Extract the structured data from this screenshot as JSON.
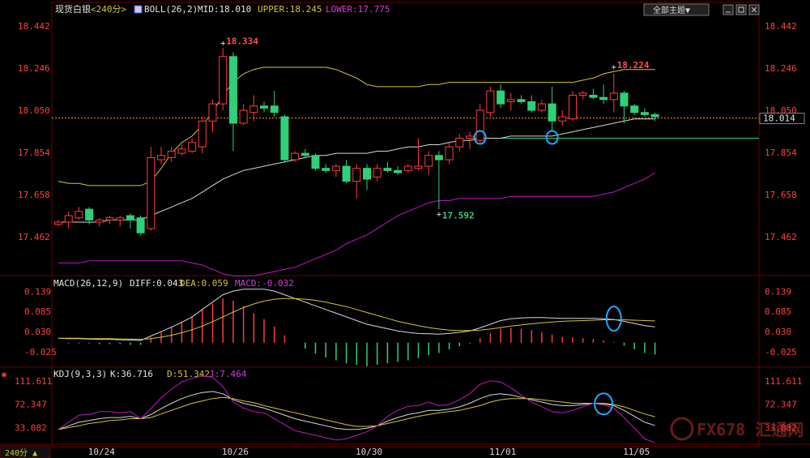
{
  "header": {
    "instrument": "现货白银",
    "period": "<240分>",
    "boll_label": "BOLL(26,2)",
    "mid_label": "MID:18.010",
    "upper_label": "UPPER:18.245",
    "lower_label": "LOWER:17.775",
    "theme_button": "全部主题▼"
  },
  "macd_header": {
    "label": "MACD(26,12,9)",
    "diff_label": "DIFF:0.043",
    "dea_label": "DEA:0.059",
    "macd_label": "MACD:-0.032"
  },
  "kdj_header": {
    "label": "KDJ(9,3,3)",
    "k_label": "K:36.716",
    "d_label": "D:51.342",
    "j_label": "J:7.464"
  },
  "period_button": "240分 ▲",
  "watermark": "FX678 汇通网",
  "colors": {
    "up": "#ff3b3b",
    "down": "#2fd07a",
    "upper": "#d4c434",
    "mid": "#d8d8d8",
    "lower": "#c018c0",
    "axis_text": "#ff4040",
    "header_text": "#d0d0d0",
    "dea": "#d4c434",
    "macd_neg": "#c018c0",
    "current_line": "#ff9900"
  },
  "chart_data": [
    {
      "type": "candlestick",
      "price_axis": {
        "ticks": [
          "18.442",
          "18.246",
          "18.050",
          "17.854",
          "17.658",
          "17.462"
        ],
        "ylim": [
          17.3,
          18.48
        ]
      },
      "x_labels": [
        {
          "label": "10/24",
          "index": 4
        },
        {
          "label": "10/26",
          "index": 17
        },
        {
          "label": "10/30",
          "index": 30
        },
        {
          "label": "11/01",
          "index": 43
        },
        {
          "label": "11/05",
          "index": 56
        }
      ],
      "annotations": [
        {
          "label": "18.334",
          "index": 16,
          "value": 18.334,
          "kind": "high"
        },
        {
          "label": "17.592",
          "index": 37,
          "value": 17.592,
          "kind": "low"
        },
        {
          "label": "18.224",
          "index": 54,
          "value": 18.224,
          "kind": "high"
        }
      ],
      "current_price": {
        "label": "18.014",
        "value": 18.014
      },
      "support_level": 17.92,
      "circles": [
        {
          "index": 41,
          "value": 17.92
        },
        {
          "index": 48,
          "value": 17.92
        }
      ],
      "candles": [
        {
          "o": 17.52,
          "h": 17.54,
          "l": 17.51,
          "c": 17.53
        },
        {
          "o": 17.53,
          "h": 17.58,
          "l": 17.5,
          "c": 17.56
        },
        {
          "o": 17.55,
          "h": 17.6,
          "l": 17.54,
          "c": 17.58
        },
        {
          "o": 17.59,
          "h": 17.6,
          "l": 17.52,
          "c": 17.54
        },
        {
          "o": 17.53,
          "h": 17.55,
          "l": 17.51,
          "c": 17.54
        },
        {
          "o": 17.54,
          "h": 17.56,
          "l": 17.52,
          "c": 17.55
        },
        {
          "o": 17.54,
          "h": 17.56,
          "l": 17.51,
          "c": 17.55
        },
        {
          "o": 17.56,
          "h": 17.57,
          "l": 17.5,
          "c": 17.54
        },
        {
          "o": 17.55,
          "h": 17.56,
          "l": 17.47,
          "c": 17.48
        },
        {
          "o": 17.5,
          "h": 17.88,
          "l": 17.49,
          "c": 17.83
        },
        {
          "o": 17.82,
          "h": 17.88,
          "l": 17.8,
          "c": 17.84
        },
        {
          "o": 17.83,
          "h": 17.88,
          "l": 17.81,
          "c": 17.86
        },
        {
          "o": 17.85,
          "h": 17.89,
          "l": 17.84,
          "c": 17.87
        },
        {
          "o": 17.86,
          "h": 17.92,
          "l": 17.85,
          "c": 17.9
        },
        {
          "o": 17.88,
          "h": 18.02,
          "l": 17.85,
          "c": 18.0
        },
        {
          "o": 18.0,
          "h": 18.1,
          "l": 17.95,
          "c": 18.08
        },
        {
          "o": 18.08,
          "h": 18.34,
          "l": 18.05,
          "c": 18.3
        },
        {
          "o": 18.3,
          "h": 18.32,
          "l": 17.86,
          "c": 17.99
        },
        {
          "o": 17.99,
          "h": 18.08,
          "l": 17.98,
          "c": 18.05
        },
        {
          "o": 18.04,
          "h": 18.12,
          "l": 18.0,
          "c": 18.07
        },
        {
          "o": 18.07,
          "h": 18.09,
          "l": 18.04,
          "c": 18.06
        },
        {
          "o": 18.07,
          "h": 18.14,
          "l": 18.02,
          "c": 18.04
        },
        {
          "o": 18.02,
          "h": 18.03,
          "l": 17.81,
          "c": 17.82
        },
        {
          "o": 17.82,
          "h": 17.86,
          "l": 17.81,
          "c": 17.85
        },
        {
          "o": 17.85,
          "h": 17.87,
          "l": 17.83,
          "c": 17.84
        },
        {
          "o": 17.84,
          "h": 17.85,
          "l": 17.77,
          "c": 17.78
        },
        {
          "o": 17.78,
          "h": 17.8,
          "l": 17.76,
          "c": 17.77
        },
        {
          "o": 17.77,
          "h": 17.8,
          "l": 17.74,
          "c": 17.79
        },
        {
          "o": 17.79,
          "h": 17.82,
          "l": 17.71,
          "c": 17.72
        },
        {
          "o": 17.72,
          "h": 17.8,
          "l": 17.64,
          "c": 17.78
        },
        {
          "o": 17.78,
          "h": 17.8,
          "l": 17.68,
          "c": 17.73
        },
        {
          "o": 17.74,
          "h": 17.8,
          "l": 17.72,
          "c": 17.78
        },
        {
          "o": 17.78,
          "h": 17.81,
          "l": 17.76,
          "c": 17.77
        },
        {
          "o": 17.77,
          "h": 17.79,
          "l": 17.75,
          "c": 17.76
        },
        {
          "o": 17.77,
          "h": 17.8,
          "l": 17.76,
          "c": 17.79
        },
        {
          "o": 17.78,
          "h": 17.92,
          "l": 17.77,
          "c": 17.79
        },
        {
          "o": 17.79,
          "h": 17.86,
          "l": 17.75,
          "c": 17.84
        },
        {
          "o": 17.84,
          "h": 17.86,
          "l": 17.59,
          "c": 17.82
        },
        {
          "o": 17.82,
          "h": 17.9,
          "l": 17.8,
          "c": 17.88
        },
        {
          "o": 17.88,
          "h": 17.94,
          "l": 17.86,
          "c": 17.92
        },
        {
          "o": 17.92,
          "h": 17.95,
          "l": 17.87,
          "c": 17.93
        },
        {
          "o": 17.91,
          "h": 18.08,
          "l": 17.9,
          "c": 18.05
        },
        {
          "o": 18.04,
          "h": 18.16,
          "l": 18.02,
          "c": 18.14
        },
        {
          "o": 18.14,
          "h": 18.17,
          "l": 18.06,
          "c": 18.08
        },
        {
          "o": 18.09,
          "h": 18.13,
          "l": 18.05,
          "c": 18.1
        },
        {
          "o": 18.1,
          "h": 18.12,
          "l": 18.08,
          "c": 18.09
        },
        {
          "o": 18.09,
          "h": 18.12,
          "l": 18.04,
          "c": 18.05
        },
        {
          "o": 18.05,
          "h": 18.1,
          "l": 18.04,
          "c": 18.08
        },
        {
          "o": 18.08,
          "h": 18.16,
          "l": 17.95,
          "c": 18.0
        },
        {
          "o": 18.0,
          "h": 18.05,
          "l": 17.98,
          "c": 18.02
        },
        {
          "o": 18.01,
          "h": 18.14,
          "l": 18.0,
          "c": 18.12
        },
        {
          "o": 18.12,
          "h": 18.14,
          "l": 18.1,
          "c": 18.13
        },
        {
          "o": 18.12,
          "h": 18.15,
          "l": 18.1,
          "c": 18.11
        },
        {
          "o": 18.11,
          "h": 18.17,
          "l": 18.08,
          "c": 18.1
        },
        {
          "o": 18.1,
          "h": 18.22,
          "l": 18.04,
          "c": 18.13
        },
        {
          "o": 18.13,
          "h": 18.14,
          "l": 17.99,
          "c": 18.07
        },
        {
          "o": 18.07,
          "h": 18.08,
          "l": 18.03,
          "c": 18.04
        },
        {
          "o": 18.04,
          "h": 18.06,
          "l": 18.02,
          "c": 18.03
        },
        {
          "o": 18.03,
          "h": 18.04,
          "l": 18.0,
          "c": 18.02
        }
      ],
      "series": [
        {
          "name": "UPPER",
          "values": [
            17.72,
            17.71,
            17.71,
            17.7,
            17.7,
            17.7,
            17.7,
            17.7,
            17.7,
            17.72,
            17.78,
            17.85,
            17.9,
            17.93,
            17.98,
            18.04,
            18.12,
            18.18,
            18.22,
            18.24,
            18.25,
            18.25,
            18.25,
            18.25,
            18.25,
            18.25,
            18.25,
            18.24,
            18.22,
            18.2,
            18.17,
            18.16,
            18.16,
            18.16,
            18.16,
            18.16,
            18.17,
            18.17,
            18.18,
            18.18,
            18.18,
            18.18,
            18.18,
            18.18,
            18.18,
            18.18,
            18.18,
            18.18,
            18.18,
            18.18,
            18.18,
            18.19,
            18.2,
            18.22,
            18.23,
            18.24,
            18.24,
            18.24,
            18.24
          ]
        },
        {
          "name": "MID",
          "values": [
            17.53,
            17.53,
            17.53,
            17.53,
            17.53,
            17.54,
            17.54,
            17.54,
            17.54,
            17.56,
            17.58,
            17.6,
            17.62,
            17.64,
            17.67,
            17.7,
            17.73,
            17.75,
            17.77,
            17.78,
            17.79,
            17.8,
            17.81,
            17.82,
            17.83,
            17.84,
            17.84,
            17.85,
            17.85,
            17.85,
            17.85,
            17.86,
            17.86,
            17.87,
            17.88,
            17.88,
            17.89,
            17.89,
            17.9,
            17.91,
            17.91,
            17.92,
            17.92,
            17.92,
            17.93,
            17.93,
            17.93,
            17.93,
            17.93,
            17.94,
            17.95,
            17.96,
            17.97,
            17.98,
            17.99,
            18.0,
            18.01,
            18.01,
            18.01
          ]
        },
        {
          "name": "LOWER",
          "values": [
            17.34,
            17.34,
            17.34,
            17.35,
            17.35,
            17.35,
            17.35,
            17.35,
            17.35,
            17.35,
            17.35,
            17.35,
            17.35,
            17.34,
            17.33,
            17.31,
            17.29,
            17.28,
            17.28,
            17.28,
            17.29,
            17.3,
            17.31,
            17.32,
            17.34,
            17.36,
            17.38,
            17.4,
            17.43,
            17.45,
            17.47,
            17.5,
            17.53,
            17.56,
            17.58,
            17.6,
            17.62,
            17.63,
            17.63,
            17.64,
            17.64,
            17.64,
            17.64,
            17.64,
            17.65,
            17.65,
            17.65,
            17.65,
            17.65,
            17.65,
            17.65,
            17.65,
            17.65,
            17.66,
            17.67,
            17.69,
            17.71,
            17.73,
            17.76
          ]
        }
      ]
    },
    {
      "type": "macd",
      "ticks": [
        "0.139",
        "0.085",
        "0.030",
        "-0.025"
      ],
      "ylim": [
        -0.06,
        0.16
      ],
      "series": [
        {
          "name": "DIFF",
          "values": [
            0.012,
            0.011,
            0.011,
            0.01,
            0.009,
            0.009,
            0.008,
            0.007,
            0.006,
            0.018,
            0.03,
            0.042,
            0.055,
            0.07,
            0.09,
            0.11,
            0.13,
            0.14,
            0.145,
            0.145,
            0.145,
            0.14,
            0.13,
            0.12,
            0.11,
            0.1,
            0.09,
            0.08,
            0.07,
            0.06,
            0.05,
            0.044,
            0.038,
            0.032,
            0.028,
            0.025,
            0.024,
            0.023,
            0.025,
            0.028,
            0.032,
            0.04,
            0.05,
            0.06,
            0.065,
            0.067,
            0.068,
            0.068,
            0.067,
            0.066,
            0.066,
            0.066,
            0.066,
            0.065,
            0.063,
            0.058,
            0.052,
            0.046,
            0.043
          ]
        },
        {
          "name": "DEA",
          "values": [
            0.012,
            0.012,
            0.012,
            0.011,
            0.011,
            0.011,
            0.01,
            0.01,
            0.009,
            0.011,
            0.015,
            0.02,
            0.027,
            0.035,
            0.045,
            0.057,
            0.07,
            0.083,
            0.095,
            0.105,
            0.113,
            0.118,
            0.12,
            0.12,
            0.118,
            0.115,
            0.11,
            0.104,
            0.098,
            0.09,
            0.082,
            0.074,
            0.066,
            0.058,
            0.052,
            0.046,
            0.041,
            0.037,
            0.034,
            0.033,
            0.033,
            0.034,
            0.037,
            0.041,
            0.045,
            0.048,
            0.051,
            0.054,
            0.056,
            0.058,
            0.059,
            0.06,
            0.061,
            0.062,
            0.062,
            0.062,
            0.061,
            0.06,
            0.059
          ]
        },
        {
          "name": "MACD",
          "values": [
            0.0,
            -0.002,
            -0.002,
            -0.002,
            -0.004,
            -0.004,
            -0.004,
            -0.006,
            -0.006,
            0.014,
            0.03,
            0.044,
            0.056,
            0.07,
            0.09,
            0.106,
            0.12,
            0.114,
            0.1,
            0.08,
            0.064,
            0.044,
            0.02,
            0.0,
            -0.016,
            -0.03,
            -0.04,
            -0.048,
            -0.056,
            -0.06,
            -0.064,
            -0.06,
            -0.056,
            -0.052,
            -0.048,
            -0.042,
            -0.034,
            -0.028,
            -0.018,
            -0.01,
            -0.002,
            0.012,
            0.026,
            0.038,
            0.04,
            0.038,
            0.034,
            0.028,
            0.022,
            0.016,
            0.014,
            0.012,
            0.01,
            0.006,
            0.002,
            -0.008,
            -0.018,
            -0.028,
            -0.032
          ]
        }
      ]
    },
    {
      "type": "kdj",
      "ticks": [
        "111.611",
        "72.347",
        "33.082"
      ],
      "ylim": [
        5,
        128
      ],
      "series": [
        {
          "name": "K",
          "values": [
            30,
            36,
            42,
            45,
            48,
            50,
            50,
            52,
            48,
            55,
            65,
            74,
            82,
            88,
            92,
            94,
            90,
            80,
            74,
            70,
            66,
            60,
            54,
            48,
            44,
            40,
            36,
            32,
            30,
            30,
            32,
            36,
            44,
            50,
            55,
            58,
            62,
            62,
            64,
            68,
            74,
            82,
            88,
            90,
            88,
            84,
            80,
            76,
            72,
            70,
            70,
            72,
            74,
            73,
            70,
            62,
            52,
            42,
            36.7
          ]
        },
        {
          "name": "D",
          "values": [
            30,
            33,
            36,
            40,
            42,
            45,
            46,
            48,
            48,
            50,
            56,
            62,
            68,
            74,
            78,
            82,
            84,
            82,
            78,
            75,
            70,
            66,
            62,
            58,
            54,
            50,
            46,
            42,
            38,
            35,
            35,
            36,
            40,
            44,
            48,
            52,
            55,
            58,
            60,
            62,
            66,
            70,
            76,
            80,
            82,
            82,
            82,
            80,
            78,
            76,
            74,
            74,
            74,
            74,
            72,
            68,
            62,
            56,
            51.3
          ]
        },
        {
          "name": "J",
          "values": [
            30,
            42,
            54,
            55,
            60,
            60,
            58,
            60,
            48,
            65,
            83,
            98,
            110,
            116,
            120,
            118,
            102,
            76,
            66,
            60,
            58,
            48,
            38,
            28,
            24,
            20,
            16,
            12,
            14,
            20,
            26,
            36,
            52,
            62,
            69,
            70,
            76,
            70,
            72,
            80,
            90,
            106,
            112,
            110,
            100,
            88,
            76,
            68,
            60,
            58,
            62,
            68,
            74,
            71,
            66,
            50,
            32,
            14,
            7.5
          ]
        }
      ]
    }
  ]
}
